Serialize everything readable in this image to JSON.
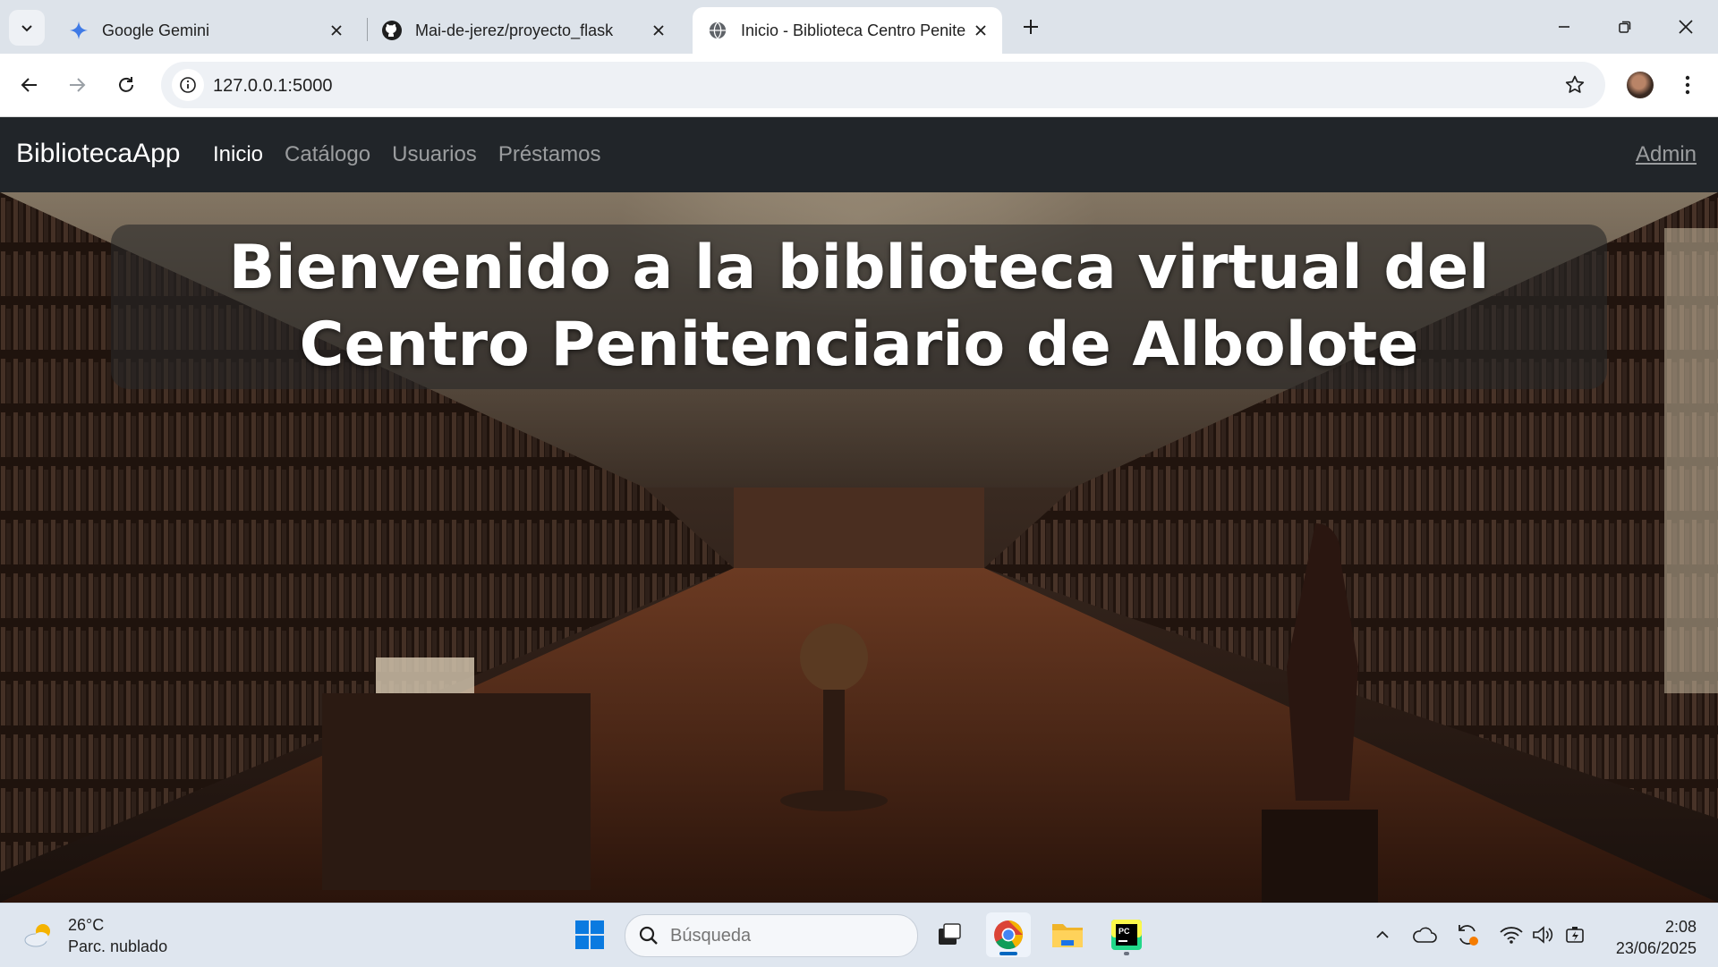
{
  "browser": {
    "tabs": [
      {
        "title": "Google Gemini",
        "active": false
      },
      {
        "title": "Mai-de-jerez/proyecto_flask",
        "active": false
      },
      {
        "title": "Inicio - Biblioteca Centro Penite",
        "active": true
      }
    ],
    "address": "127.0.0.1:5000"
  },
  "site": {
    "brand": "BibliotecaApp",
    "nav": [
      {
        "label": "Inicio",
        "active": true
      },
      {
        "label": "Catálogo",
        "active": false
      },
      {
        "label": "Usuarios",
        "active": false
      },
      {
        "label": "Préstamos",
        "active": false
      }
    ],
    "admin": "Admin",
    "hero_title": "Bienvenido a la biblioteca virtual del Centro Penitenciario de Albolote"
  },
  "taskbar": {
    "weather_temp": "26°C",
    "weather_desc": "Parc. nublado",
    "search_placeholder": "Búsqueda",
    "time": "2:08",
    "date": "23/06/2025"
  },
  "colors": {
    "navbar_bg": "#212529",
    "tabstrip_bg": "#dde3ea",
    "taskbar_bg": "#dfe6ef",
    "accent": "#0067c0"
  }
}
